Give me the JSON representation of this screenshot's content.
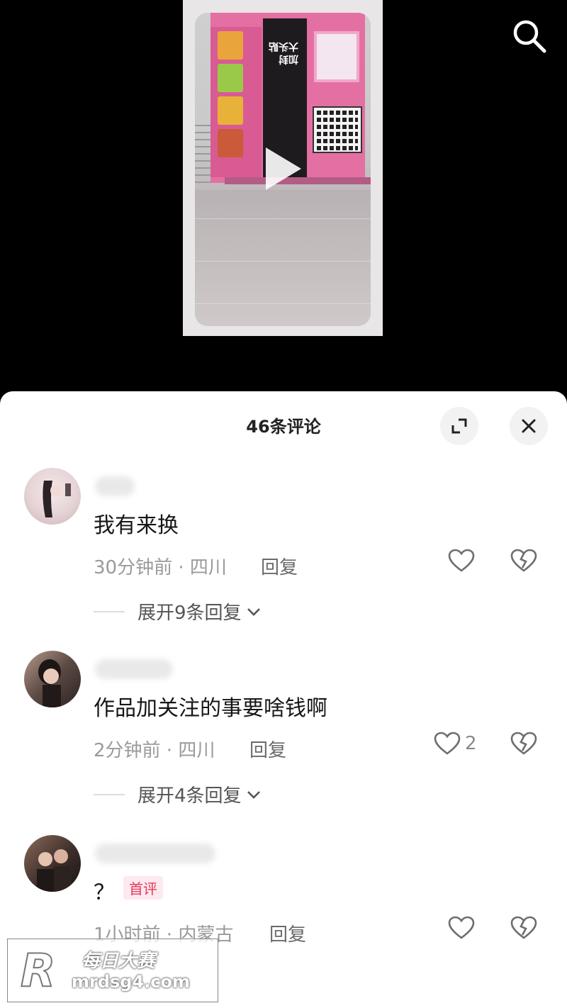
{
  "header": {
    "search_icon": "search-icon"
  },
  "video": {
    "kiosk_sign": "加封\n大头贴",
    "play_icon": "play-icon"
  },
  "sheet": {
    "title": "46条评论",
    "expand_icon": "expand-icon",
    "close_icon": "close-icon"
  },
  "comments": [
    {
      "text": "我有来换",
      "meta": "30分钟前 · 四川",
      "reply": "回复",
      "like_count": "",
      "expand": "展开9条回复"
    },
    {
      "text": "作品加关注的事要啥钱啊",
      "meta": "2分钟前 · 四川",
      "reply": "回复",
      "like_count": "2",
      "expand": "展开4条回复"
    },
    {
      "text": "？",
      "badge": "首评",
      "meta": "1小时前 · 内蒙古",
      "reply": "回复",
      "like_count": ""
    }
  ],
  "watermark": {
    "logo": "R",
    "title": "每日大赛",
    "url": "mrdsg4.com"
  },
  "colors": {
    "kiosk_pink": "#e46fa3",
    "badge_red": "#e8365d",
    "meta_gray": "#9a9a9a"
  }
}
